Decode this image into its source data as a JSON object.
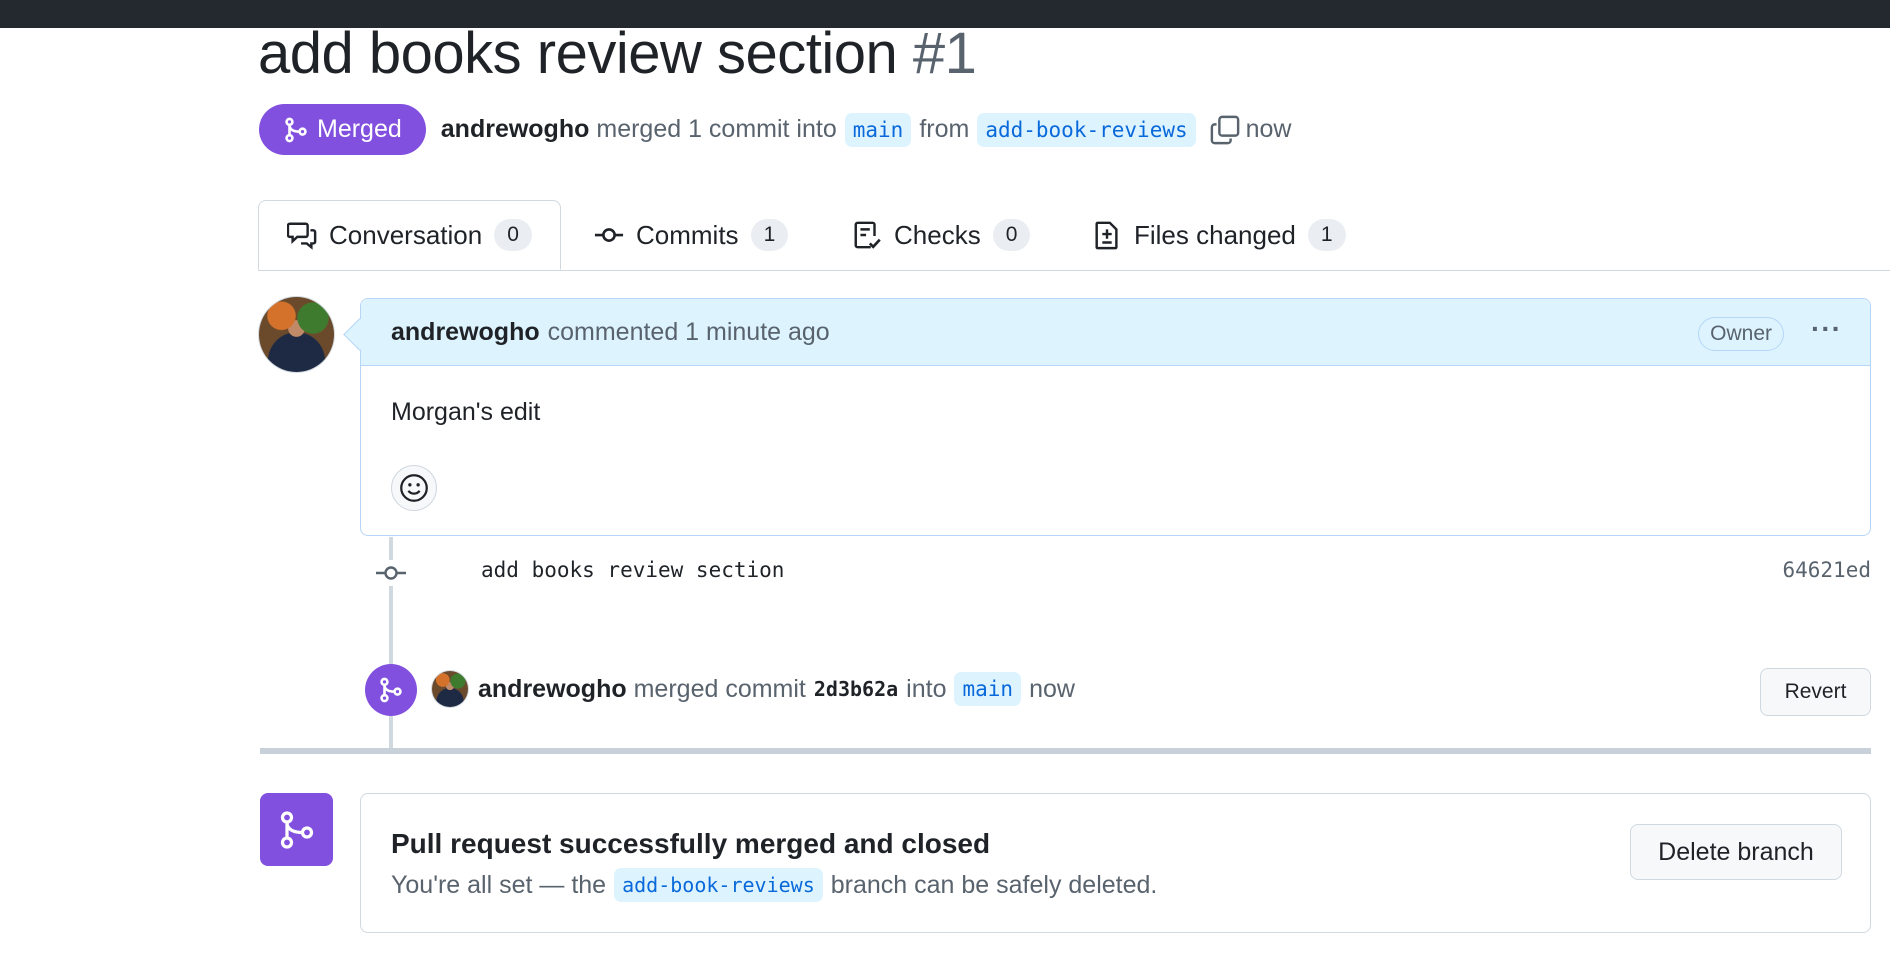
{
  "pr": {
    "title": "add books review section",
    "number": "#1",
    "status_label": "Merged",
    "author": "andrewogho",
    "merge_text": "merged 1 commit into",
    "base_branch": "main",
    "from_text": "from",
    "head_branch": "add-book-reviews",
    "time": "now"
  },
  "tabs": [
    {
      "label": "Conversation",
      "count": "0",
      "icon": "comment-discussion-icon"
    },
    {
      "label": "Commits",
      "count": "1",
      "icon": "git-commit-icon"
    },
    {
      "label": "Checks",
      "count": "0",
      "icon": "checklist-icon"
    },
    {
      "label": "Files changed",
      "count": "1",
      "icon": "file-diff-icon"
    }
  ],
  "comment": {
    "author": "andrewogho",
    "meta": "commented 1 minute ago",
    "role": "Owner",
    "body": "Morgan's edit"
  },
  "commit": {
    "message": "add books review section",
    "sha": "64621ed"
  },
  "merge_event": {
    "author": "andrewogho",
    "text1": "merged commit",
    "sha": "2d3b62a",
    "text2": "into",
    "branch": "main",
    "time": "now",
    "revert_label": "Revert"
  },
  "merged_box": {
    "title": "Pull request successfully merged and closed",
    "sub_before": "You're all set — the",
    "branch": "add-book-reviews",
    "sub_after": "branch can be safely deleted.",
    "delete_label": "Delete branch"
  },
  "colors": {
    "merged_purple": "#8250df",
    "branch_bg": "#ddf4ff",
    "branch_fg": "#0969da",
    "topbar": "#24292f"
  }
}
